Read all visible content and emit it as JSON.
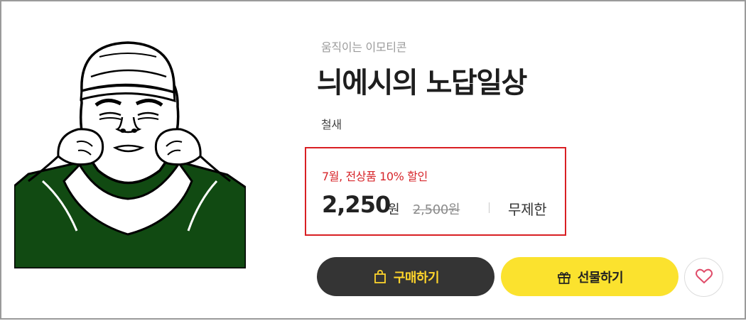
{
  "product": {
    "category": "움직이는 이모티콘",
    "title": "늬에시의 노답일상",
    "author": "철새"
  },
  "price": {
    "promo_label": "7월, 전상품 10% 할인",
    "current": "2,250",
    "unit": "원",
    "original": "2,500원",
    "period": "무제한"
  },
  "actions": {
    "buy_label": "구매하기",
    "gift_label": "선물하기",
    "like_icon": "heart-icon",
    "buy_icon": "shopping-bag-icon",
    "gift_icon": "gift-icon"
  },
  "colors": {
    "promo_red": "#d91f23",
    "buy_bg": "#343434",
    "buy_text": "#ffd52b",
    "gift_bg": "#fbe22e",
    "shirt_green": "#114a12",
    "heart": "#e04d6a"
  }
}
